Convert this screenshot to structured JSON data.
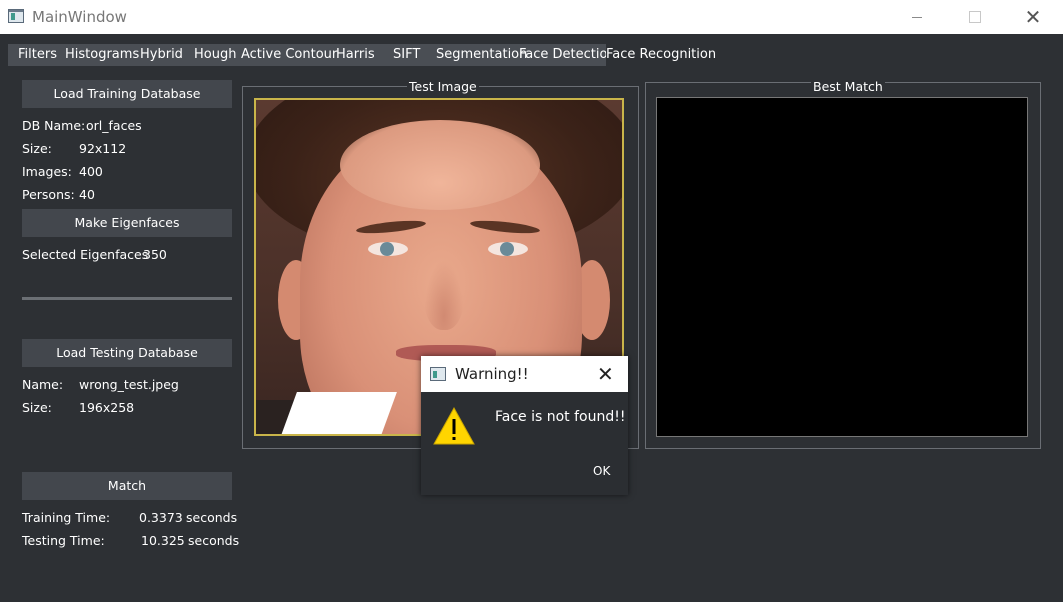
{
  "window": {
    "title": "MainWindow"
  },
  "tabs": [
    {
      "label": "Filters"
    },
    {
      "label": "Histograms"
    },
    {
      "label": "Hybrid"
    },
    {
      "label": "Hough"
    },
    {
      "label": "Active Contour"
    },
    {
      "label": "Harris"
    },
    {
      "label": "SIFT"
    },
    {
      "label": "Segmentation"
    },
    {
      "label": "Face Detection"
    },
    {
      "label": "Face Recognition"
    }
  ],
  "left": {
    "load_training_label": "Load Training Database",
    "db_name_key": "DB Name:",
    "db_name_val": "orl_faces",
    "size_key": "Size:",
    "size_val": "92x112",
    "images_key": "Images:",
    "images_val": "400",
    "persons_key": "Persons:",
    "persons_val": "40",
    "make_eigen_label": "Make Eigenfaces",
    "selected_eigen_key": "Selected Eigenfaces",
    "selected_eigen_val": "350",
    "load_testing_label": "Load Testing Database",
    "test_name_key": "Name:",
    "test_name_val": "wrong_test.jpeg",
    "test_size_key": "Size:",
    "test_size_val": "196x258",
    "match_label": "Match",
    "training_time_key": "Training Time:",
    "training_time_val": "0.3373",
    "training_time_unit": "seconds",
    "testing_time_key": "Testing Time:",
    "testing_time_val": "10.325",
    "testing_time_unit": "seconds"
  },
  "groups": {
    "test_image_title": "Test Image",
    "best_match_title": "Best Match"
  },
  "dialog": {
    "title": "Warning!!",
    "message": "Face is not found!!",
    "ok_label": "OK"
  },
  "colors": {
    "background": "#2d3034",
    "button": "#43474d",
    "image_border": "#c9b54a",
    "warning_yellow": "#ffd500"
  }
}
